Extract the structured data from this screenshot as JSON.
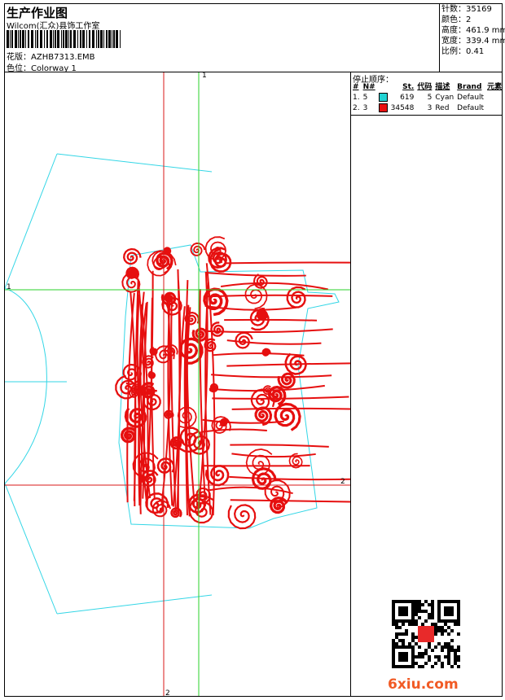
{
  "header": {
    "title": "生产作业图",
    "brand": "Wilcom(汇众)县饰工作室",
    "design_label": "花版：",
    "design_value": "AZHB7313.EMB",
    "colorway_label": "色位：",
    "colorway_value": "Colorway 1"
  },
  "stats": {
    "stitches_label": "针数：",
    "stitches_value": "35169",
    "colors_label": "颜色：",
    "colors_value": "2",
    "height_label": "高度：",
    "height_value": "461.9 mm",
    "width_label": "宽度：",
    "width_value": "339.4 mm",
    "scale_label": "比例：",
    "scale_value": "0.41"
  },
  "thread_sequence": {
    "title": "停止顺序：",
    "columns": [
      "#",
      "N#",
      "St.",
      "代码",
      "描述",
      "Brand",
      "元素"
    ],
    "rows": [
      {
        "num": "1.",
        "n": "5",
        "st": "619",
        "code": "5",
        "desc": "Cyan",
        "brand": "Default",
        "color": "#22d3d3"
      },
      {
        "num": "2.",
        "n": "3",
        "st": "34548",
        "code": "3",
        "desc": "Red",
        "brand": "Default",
        "color": "#e81010"
      }
    ]
  },
  "axes": {
    "v_top": "1",
    "h_left": "1",
    "h_right": "2",
    "v_bottom": "2"
  },
  "colors": {
    "outline": "#33d6e6",
    "embroidery": "#e60f0f",
    "guide_green": "#2ad12a",
    "guide_red": "#d81a1a"
  },
  "watermark": "6xiu.com"
}
